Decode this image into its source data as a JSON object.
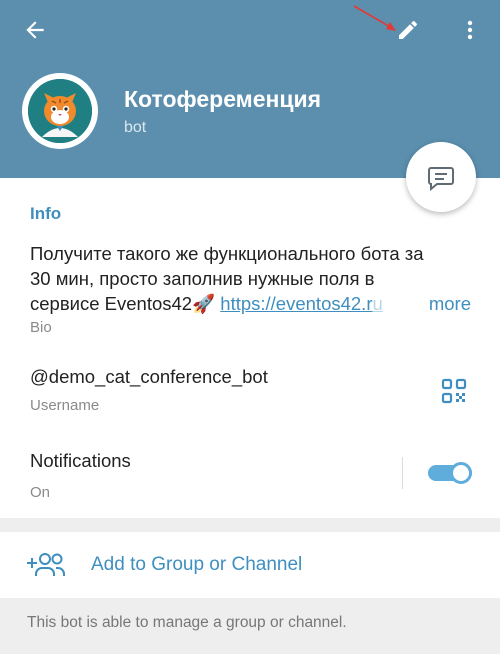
{
  "header": {
    "title": "Котофеременция",
    "subtitle": "bot",
    "icons": {
      "back": "arrow-left-icon",
      "edit": "pencil-icon",
      "more": "more-vertical-icon",
      "message": "message-bubble-icon"
    },
    "colors": {
      "background": "#5b8fad",
      "title": "#ffffff"
    }
  },
  "info": {
    "section_title": "Info",
    "bio": {
      "line1": "Получите такого же функционального бота за",
      "line2": "30 мин, просто заполнив нужные поля в",
      "line3_text": "сервисе Eventos42",
      "line3_emoji": "🚀",
      "link_visible": "https://eventos42.r",
      "link_faded": "u",
      "more": "more",
      "caption": "Bio"
    },
    "username": {
      "value": "@demo_cat_conference_bot",
      "caption": "Username",
      "icon": "qr-code-icon"
    },
    "notifications": {
      "label": "Notifications",
      "caption": "On",
      "enabled": true
    }
  },
  "actions": {
    "add_to_group": {
      "label": "Add to Group or Channel",
      "icon": "add-users-icon"
    }
  },
  "footer": {
    "text": "This bot is able to manage a group or channel."
  },
  "colors": {
    "accent": "#3e8fbf",
    "toggle": "#5eaddb",
    "annotation": "#e53935"
  }
}
